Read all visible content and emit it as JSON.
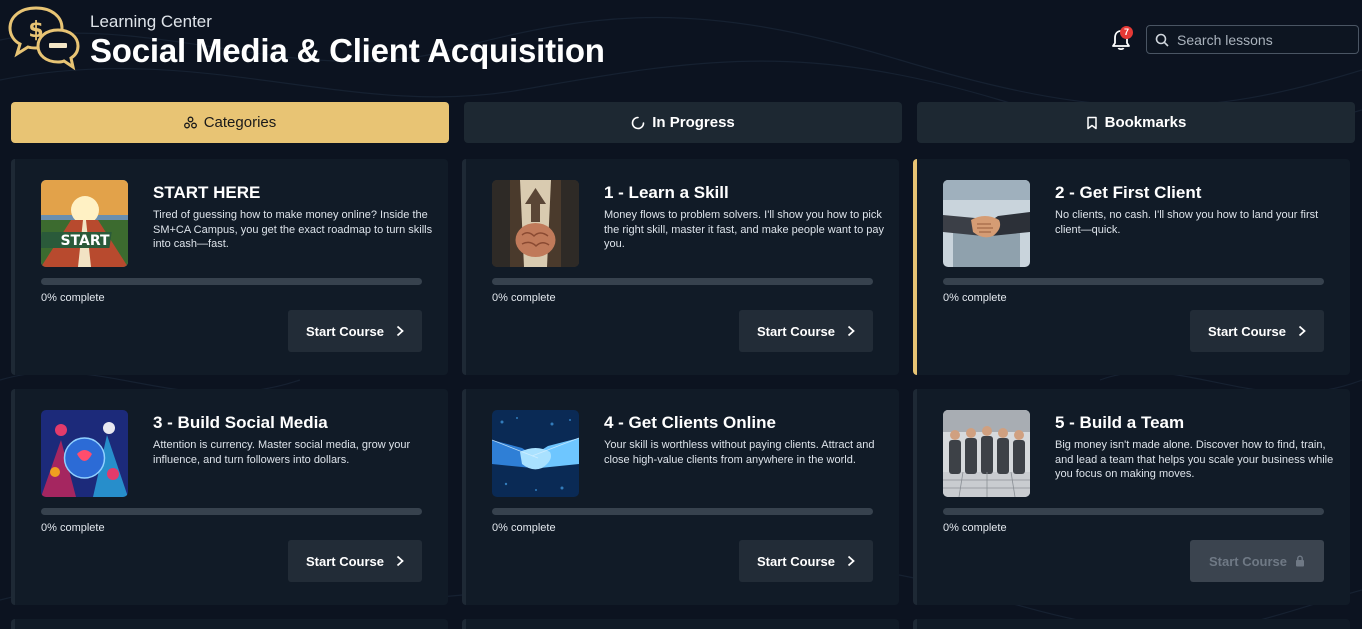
{
  "header": {
    "subtitle": "Learning Center",
    "title": "Social Media & Client Acquisition",
    "notification_count": "7",
    "search_placeholder": "Search lessons"
  },
  "tabs": [
    {
      "label": "Categories",
      "icon": "categories-icon",
      "active": true
    },
    {
      "label": "In Progress",
      "icon": "spinner-icon",
      "active": false
    },
    {
      "label": "Bookmarks",
      "icon": "bookmark-icon",
      "active": false
    }
  ],
  "courses": [
    {
      "title": "START HERE",
      "description": "Tired of guessing how to make money online? Inside the SM+CA Campus, you get the exact roadmap to turn skills into cash—fast.",
      "progress": 0,
      "progress_label": "0% complete",
      "button": "Start Course",
      "locked": false,
      "thumbnail": "start-track-image"
    },
    {
      "title": "1 - Learn a Skill",
      "description": "Money flows to problem solvers. I'll show you how to pick the right skill, master it fast, and make people want to pay you.",
      "progress": 0,
      "progress_label": "0% complete",
      "button": "Start Course",
      "locked": false,
      "thumbnail": "brain-arrow-image"
    },
    {
      "title": "2 - Get First Client",
      "description": "No clients, no cash. I'll show you how to land your first client—quick.",
      "progress": 0,
      "progress_label": "0% complete",
      "button": "Start Course",
      "locked": false,
      "thumbnail": "handshake-image"
    },
    {
      "title": "3 - Build Social Media",
      "description": "Attention is currency. Master social media, grow your influence, and turn followers into dollars.",
      "progress": 0,
      "progress_label": "0% complete",
      "button": "Start Course",
      "locked": false,
      "thumbnail": "social-globe-image"
    },
    {
      "title": "4 - Get Clients Online",
      "description": "Your skill is worthless without paying clients. Attract and close high-value clients from anywhere in the world.",
      "progress": 0,
      "progress_label": "0% complete",
      "button": "Start Course",
      "locked": false,
      "thumbnail": "digital-handshake-image"
    },
    {
      "title": "5 - Build a Team",
      "description": "Big money isn't made alone. Discover how to find, train, and lead a team that helps you scale your business while you focus on making moves.",
      "progress": 0,
      "progress_label": "0% complete",
      "button": "Start Course",
      "locked": true,
      "thumbnail": "business-team-image"
    }
  ],
  "colors": {
    "accent": "#e8c474",
    "background": "#0c1320",
    "card": "#111b27",
    "badge": "#e53935"
  }
}
